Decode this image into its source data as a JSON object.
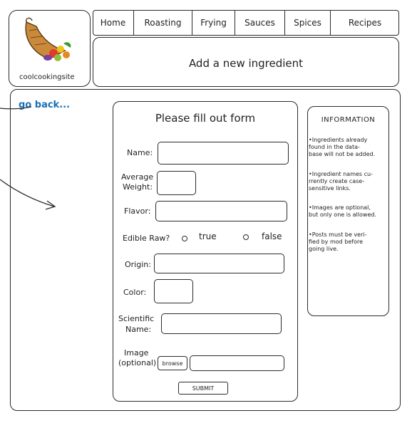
{
  "site": {
    "logo_text": "coolcookingsite"
  },
  "nav": {
    "items": [
      {
        "label": "Home"
      },
      {
        "label": "Roasting"
      },
      {
        "label": "Frying"
      },
      {
        "label": "Sauces"
      },
      {
        "label": "Spices"
      },
      {
        "label": "Recipes"
      }
    ]
  },
  "header": {
    "title": "Add a new ingredient"
  },
  "back_link": "go back...",
  "form": {
    "title": "Please fill out form",
    "name_label": "Name:",
    "weight_label_1": "Average",
    "weight_label_2": "Weight:",
    "flavor_label": "Flavor:",
    "edible_label": "Edible Raw?",
    "true_label": "true",
    "false_label": "false",
    "origin_label": "Origin:",
    "color_label": "Color:",
    "sci_label_1": "Scientific",
    "sci_label_2": "Name:",
    "image_label_1": "Image",
    "image_label_2": "(optional)",
    "browse_label": "browse",
    "submit_label": "SUBMIT"
  },
  "info": {
    "title": "INFORMATION",
    "b1": [
      "•Ingredients already",
      "found in the data-",
      "base will not be added."
    ],
    "b2": [
      "•Ingredient names cu-",
      "rrently create case-",
      "sensitive links."
    ],
    "b3": [
      "•Images are optional,",
      "but only one is allowed."
    ],
    "b4": [
      "•Posts must be veri-",
      "fied by mod before",
      "going live."
    ]
  },
  "colors": {
    "link": "#1a6fb5",
    "ink": "#2b2b2b"
  }
}
